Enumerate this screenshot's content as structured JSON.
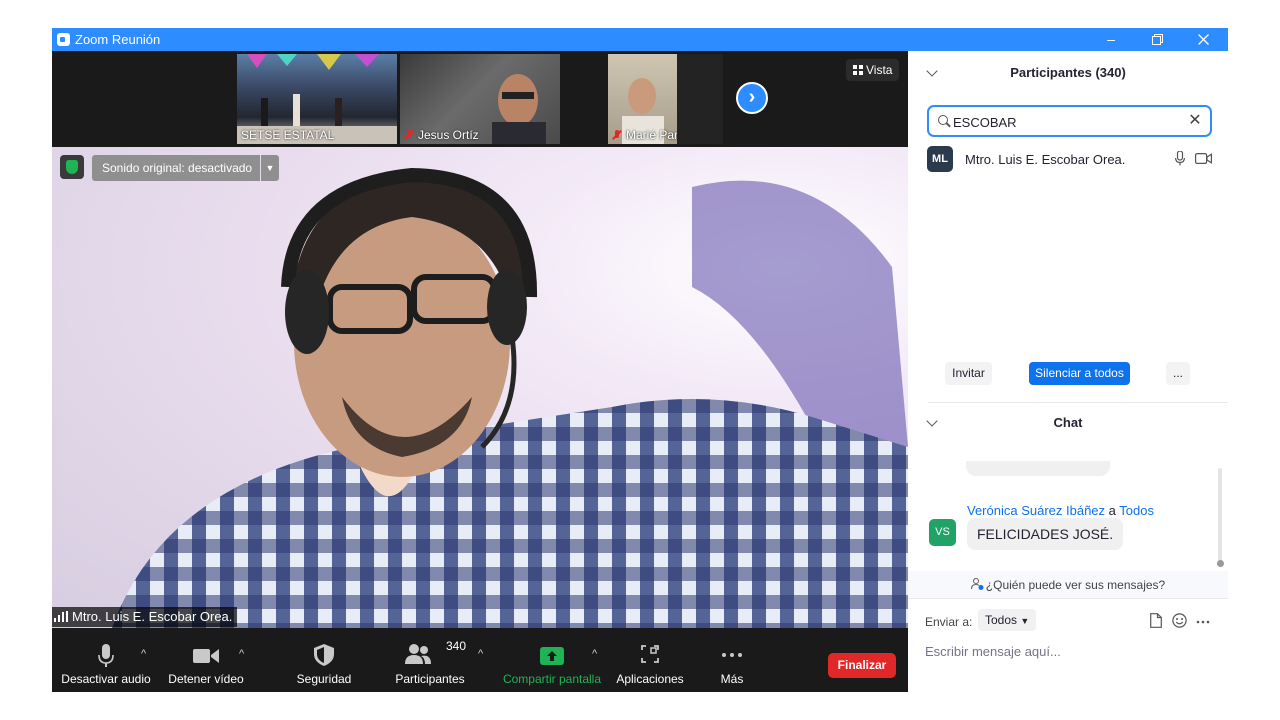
{
  "window": {
    "title": "Zoom Reunión"
  },
  "strip": {
    "thumbs": [
      {
        "name": "SETSE ESTATAL",
        "muted": false
      },
      {
        "name": "Jesus Ortíz",
        "muted": true
      },
      {
        "name": "Marié Parax",
        "muted": true
      }
    ],
    "view_label": "Vista"
  },
  "main_video": {
    "sound_label": "Sonido original: desactivado",
    "speaker_name": "Mtro. Luis E. Escobar Orea."
  },
  "toolbar": {
    "audio_label": "Desactivar audio",
    "video_label": "Detener vídeo",
    "security_label": "Seguridad",
    "participants_label": "Participantes",
    "participants_count": "340",
    "share_label": "Compartir pantalla",
    "apps_label": "Aplicaciones",
    "more_label": "Más",
    "end_label": "Finalizar"
  },
  "participants": {
    "header": "Participantes (340)",
    "search_value": "ESCOBAR",
    "list": [
      {
        "initials": "ML",
        "name": "Mtro. Luis E. Escobar Orea."
      }
    ],
    "invite_label": "Invitar",
    "mute_all_label": "Silenciar a todos",
    "more_label": "..."
  },
  "chat": {
    "header": "Chat",
    "message": {
      "sender": "Verónica Suárez Ibáñez",
      "connector": "a",
      "recipient": "Todos",
      "initials": "VS",
      "text": "FELICIDADES JOSÉ."
    },
    "who_can_see": "¿Quién puede ver sus mensajes?",
    "send_to_label": "Enviar a:",
    "send_to_value": "Todos",
    "input_placeholder": "Escribir mensaje aquí..."
  },
  "colors": {
    "zoom_blue": "#2d8cff",
    "end_red": "#e02828",
    "share_green": "#1fb356"
  }
}
